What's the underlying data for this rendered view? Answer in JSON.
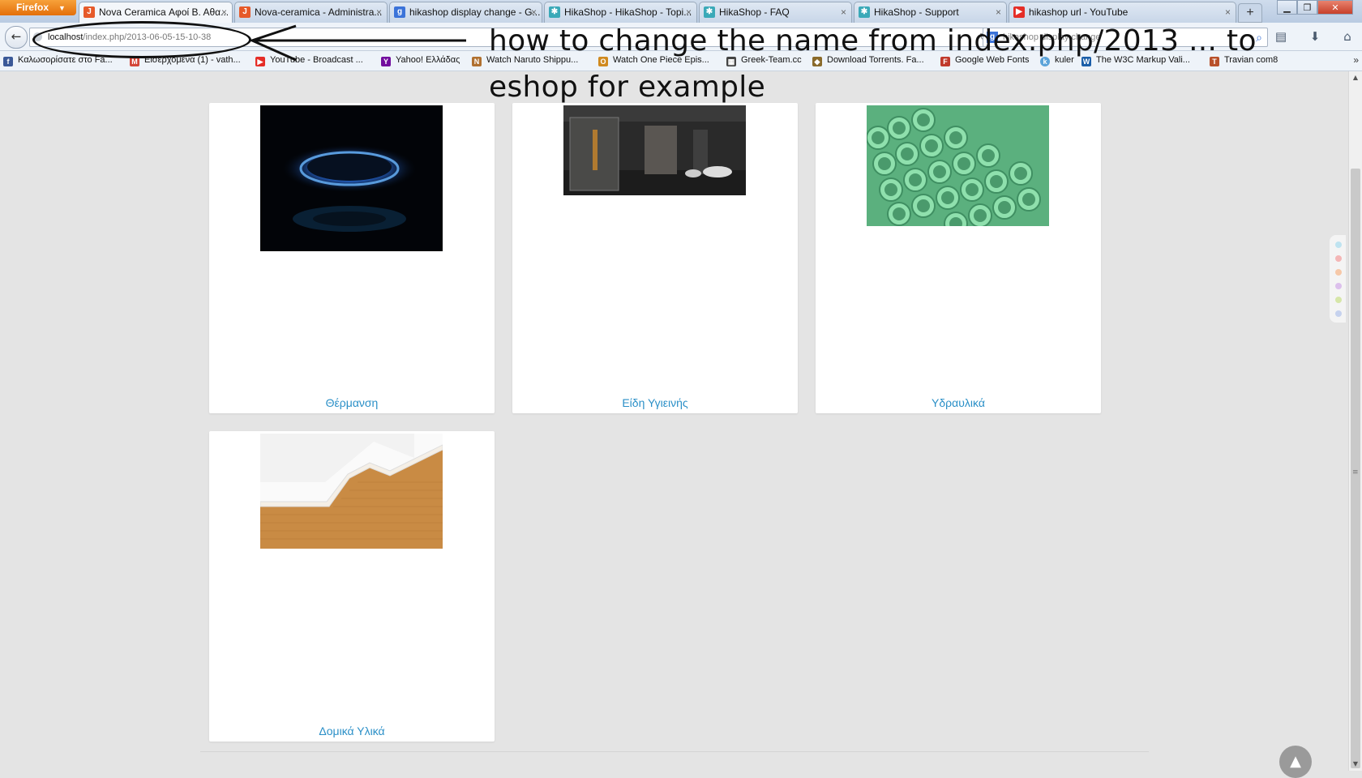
{
  "browser": {
    "menu_button": "Firefox",
    "tabs": [
      {
        "title": "Nova Ceramica Αφοί Β. Αθα...",
        "favicon": "joomla-icon",
        "active": true
      },
      {
        "title": "Nova-ceramica - Administra...",
        "favicon": "joomla-icon",
        "active": false
      },
      {
        "title": "hikashop display change - G...",
        "favicon": "google-icon",
        "active": false
      },
      {
        "title": "HikaShop - HikaShop - Topi...",
        "favicon": "hikashop-icon",
        "active": false
      },
      {
        "title": "HikaShop - FAQ",
        "favicon": "hikashop-icon",
        "active": false
      },
      {
        "title": "HikaShop - Support",
        "favicon": "hikashop-icon",
        "active": false
      },
      {
        "title": "hikashop url - YouTube",
        "favicon": "youtube-icon",
        "active": false
      }
    ],
    "new_tab": "+",
    "url_host": "localhost",
    "url_path": "/index.php/2013-06-05-15-10-38",
    "search_value": "hikashop display change",
    "bookmarks": [
      {
        "label": "Καλωσορίσατε στο Fa...",
        "icon": "facebook-icon",
        "color": "#3b5998"
      },
      {
        "label": "Εισερχόμενα (1) - vath...",
        "icon": "mail-icon",
        "color": "#d44638"
      },
      {
        "label": "YouTube - Broadcast ...",
        "icon": "youtube-icon",
        "color": "#e52d27"
      },
      {
        "label": "Yahoo! Ελλάδας",
        "icon": "yahoo-icon",
        "color": "#720e9e"
      },
      {
        "label": "Watch Naruto Shippu...",
        "icon": "naruto-icon",
        "color": "#b07030"
      },
      {
        "label": "Watch One Piece Epis...",
        "icon": "onepiece-icon",
        "color": "#d08a20"
      },
      {
        "label": "Greek-Team.cc",
        "icon": "film-icon",
        "color": "#444444"
      },
      {
        "label": "Download Torrents. Fa...",
        "icon": "shield-icon",
        "color": "#8a6a2a"
      },
      {
        "label": "Google Web Fonts",
        "icon": "fonts-icon",
        "color": "#c0392b"
      },
      {
        "label": "kuler",
        "icon": "kuler-icon",
        "color": "#5ba3d9"
      },
      {
        "label": "The W3C Markup Vali...",
        "icon": "w3c-icon",
        "color": "#1b5ea8"
      },
      {
        "label": "Travian com8",
        "icon": "travian-icon",
        "color": "#b8502a"
      }
    ]
  },
  "annotation": {
    "text": "how to change the name from index.php/2013 ... to eshop for example"
  },
  "categories": [
    {
      "name": "Θέρμανση",
      "image": "gas-burner-image"
    },
    {
      "name": "Είδη Υγιεινής",
      "image": "bathroom-image"
    },
    {
      "name": "Υδραυλικά",
      "image": "green-pipes-image"
    },
    {
      "name": "Δομικά Υλικά",
      "image": "brick-house-image"
    }
  ],
  "colors": {
    "link": "#2a8fc7",
    "page_bg": "#e4e4e4",
    "card_bg": "#ffffff"
  }
}
